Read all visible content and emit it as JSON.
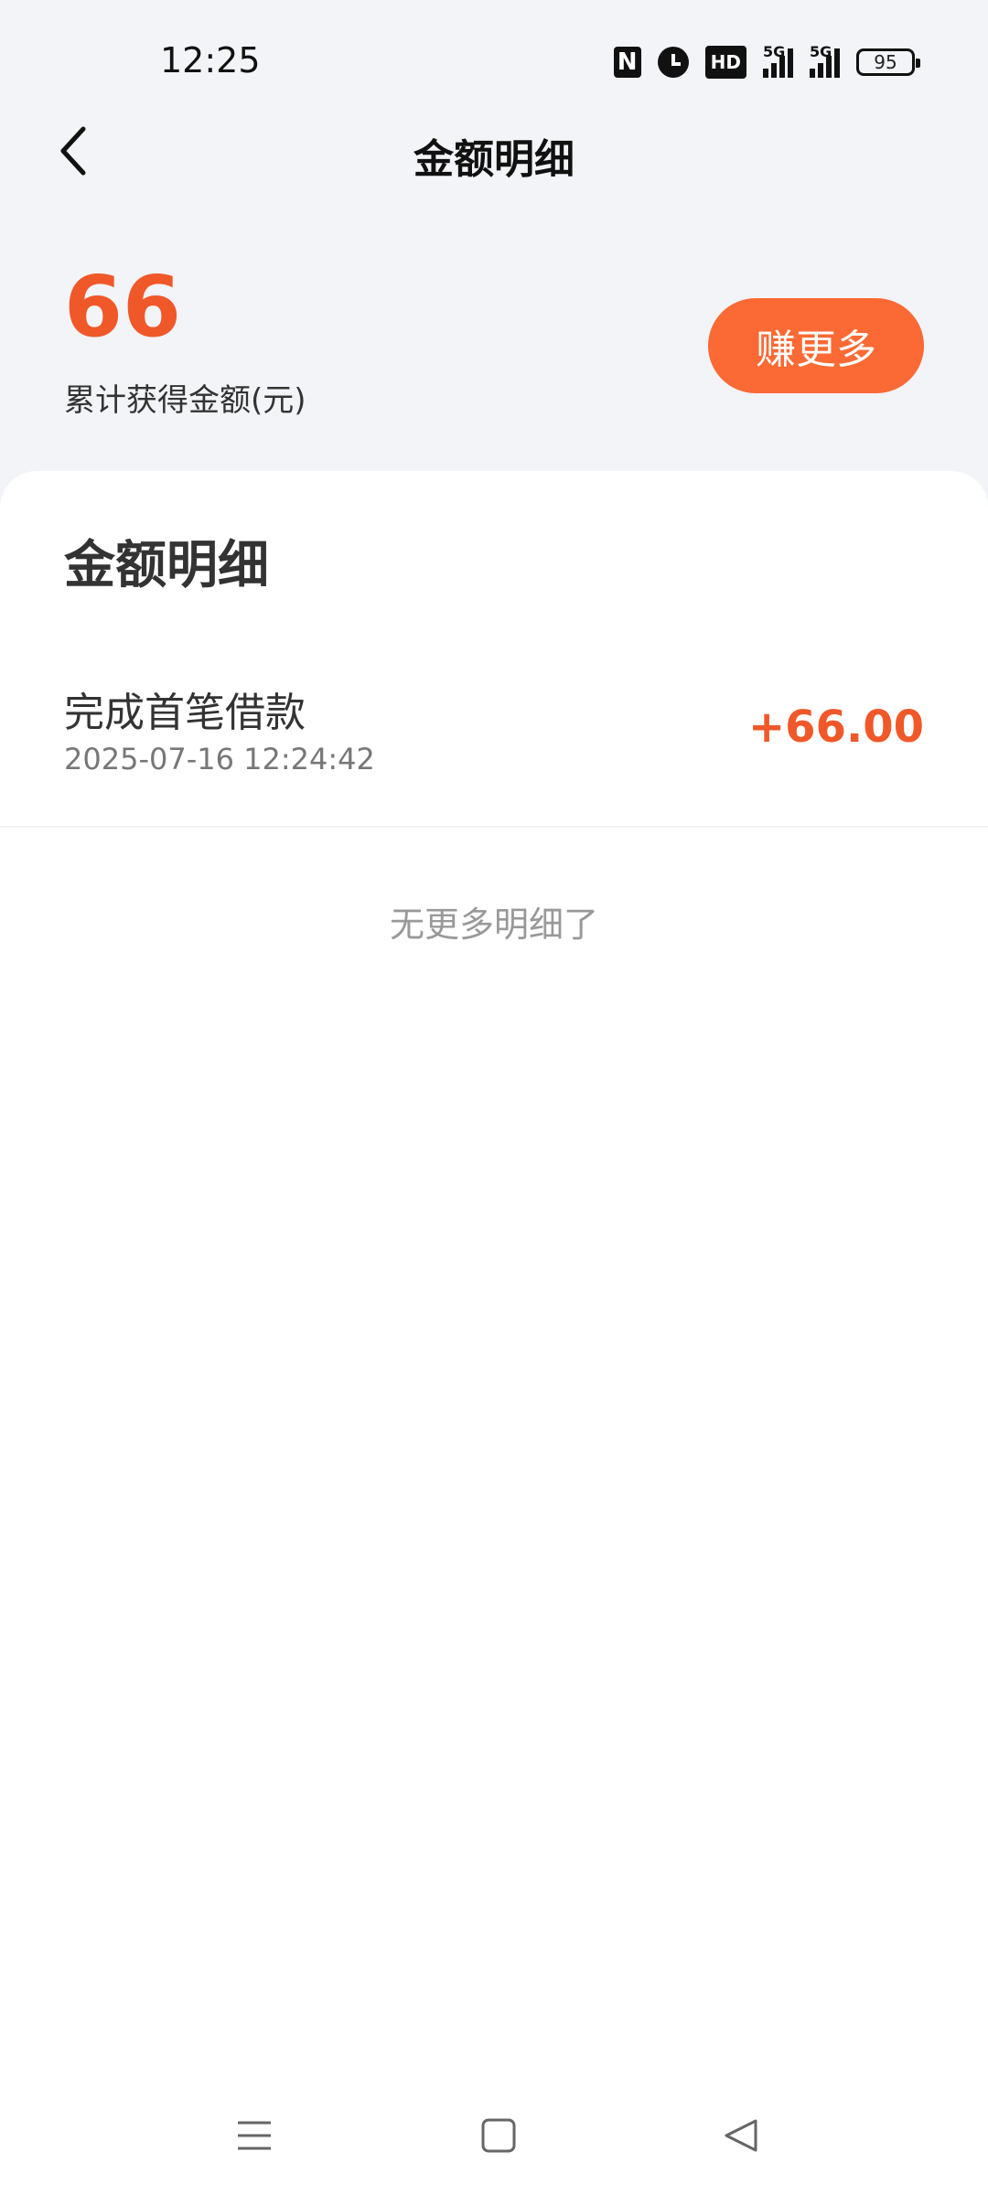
{
  "status_bar": {
    "time": "12:25",
    "battery": "95",
    "hd_label": "HD",
    "network_label_1": "5G",
    "network_label_2": "5G",
    "icons": [
      "nfc-icon",
      "alarm-icon",
      "hd-icon",
      "signal-5g-icon",
      "signal-5g-icon",
      "battery-icon"
    ]
  },
  "header": {
    "title": "金额明细",
    "back_icon": "chevron-left-icon"
  },
  "summary": {
    "total_amount": "66",
    "total_label": "累计获得金额(元)",
    "earn_more_label": "赚更多"
  },
  "details": {
    "section_title": "金额明细",
    "records": [
      {
        "name": "完成首笔借款",
        "time": "2025-07-16 12:24:42",
        "amount": "+66.00"
      }
    ],
    "no_more_text": "无更多明细了"
  },
  "nav_bar": {
    "icons": [
      "menu-icon",
      "home-icon",
      "back-icon"
    ]
  },
  "colors": {
    "accent": "#f0582a",
    "button": "#fb6a34",
    "background": "#f2f4f8"
  }
}
